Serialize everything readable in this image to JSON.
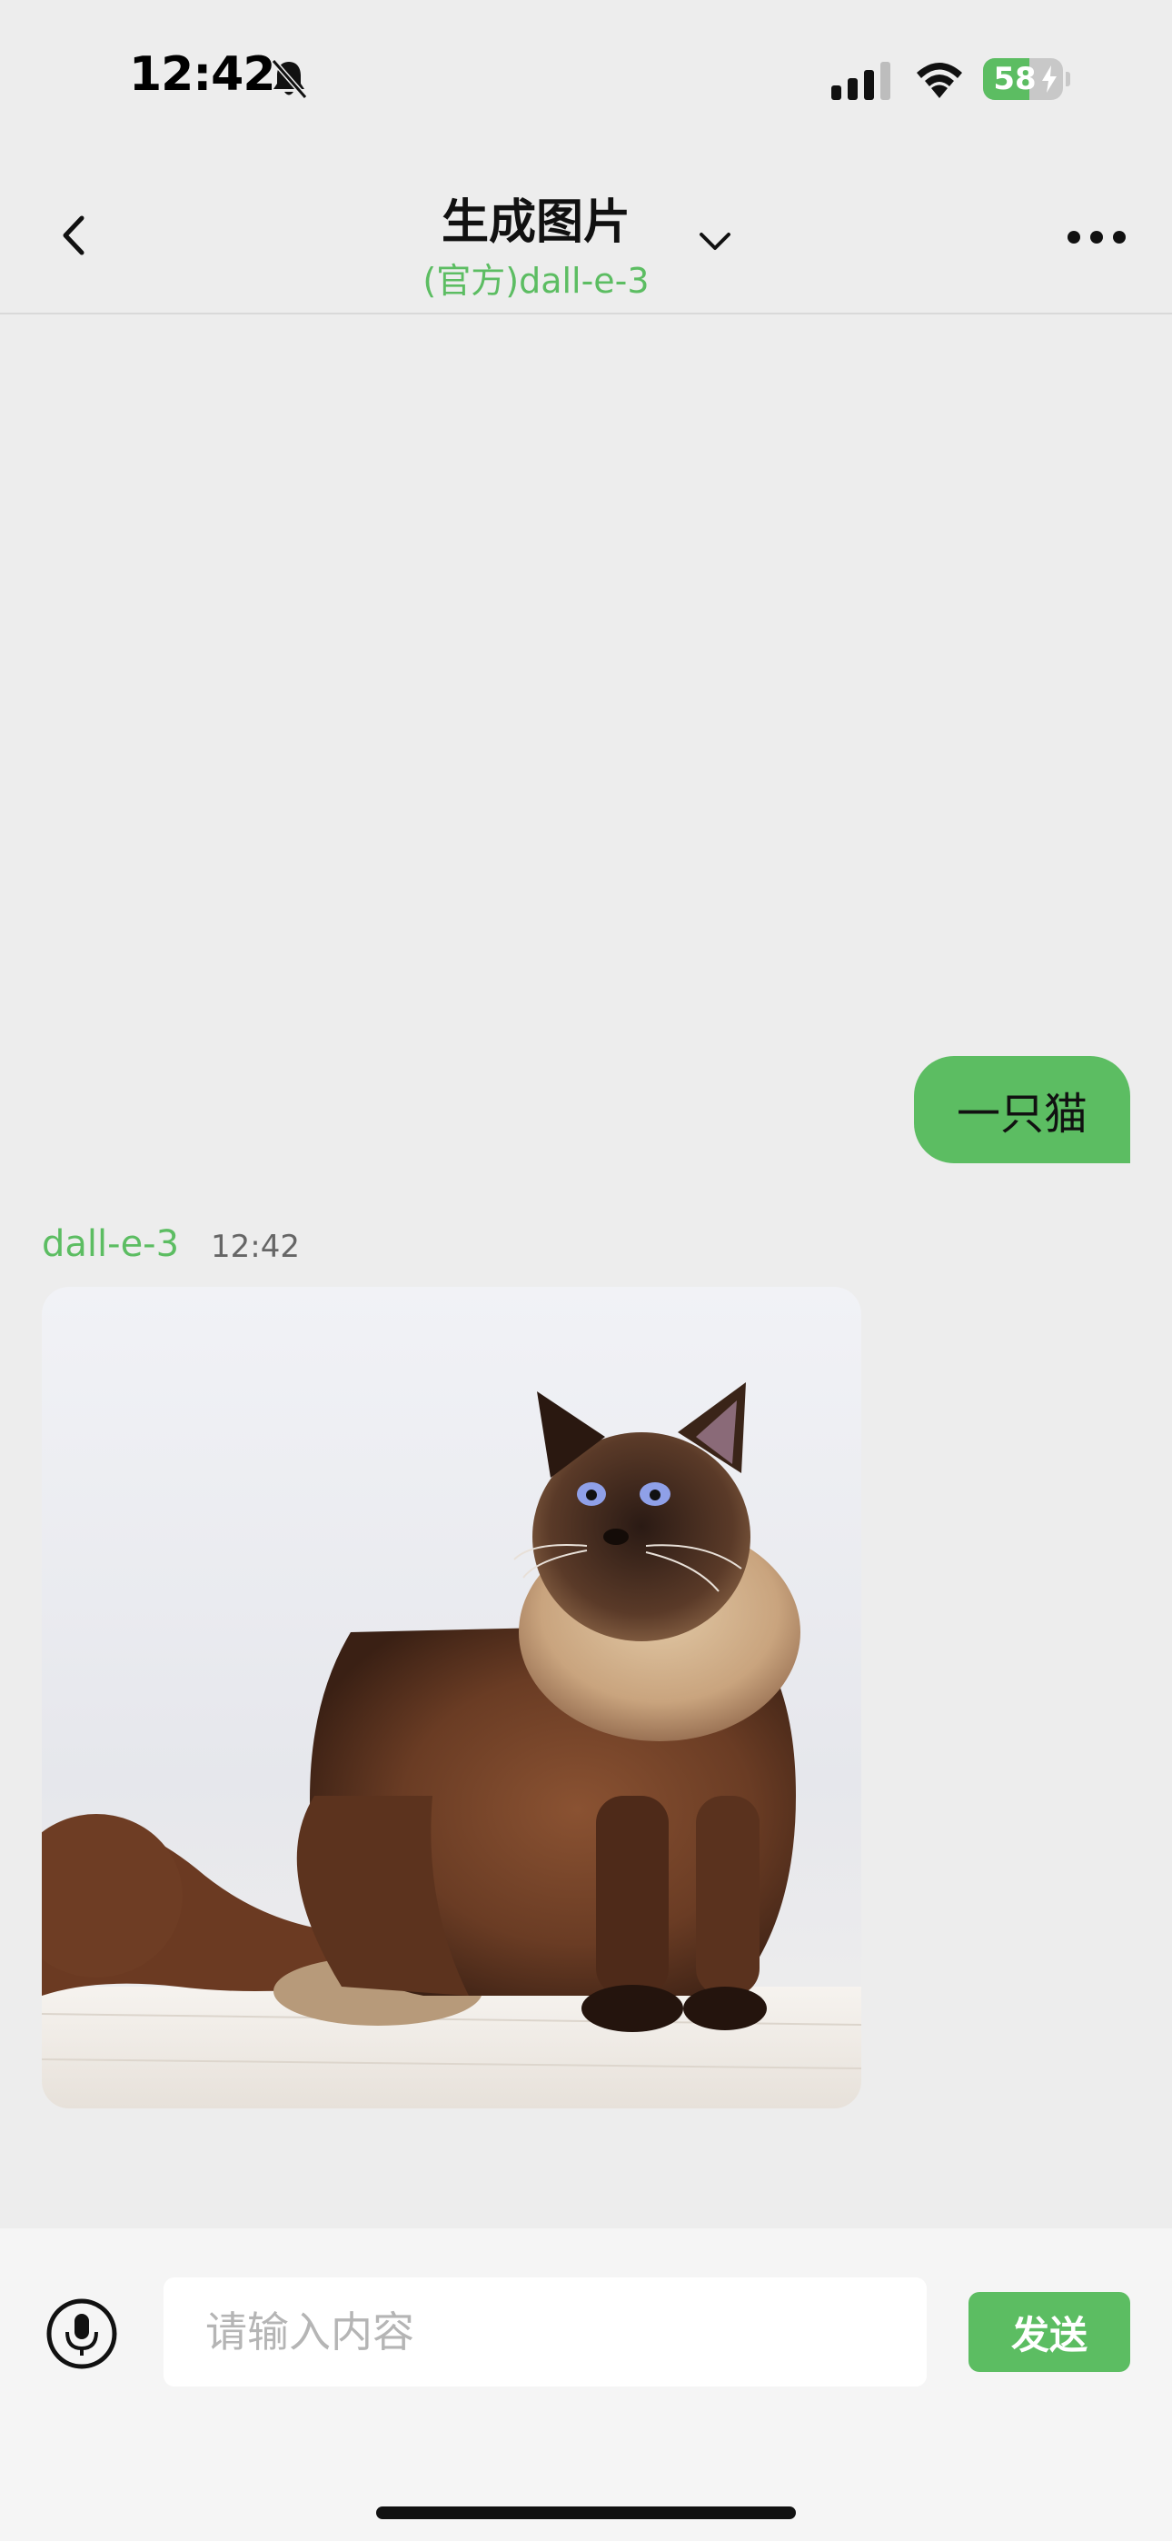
{
  "status_bar": {
    "time": "12:42",
    "battery_level": "58",
    "battery_fraction": 0.58,
    "icons": [
      "bell-slash-icon",
      "cellular-signal-icon",
      "wifi-icon",
      "battery-icon",
      "charging-bolt-icon"
    ]
  },
  "nav": {
    "title": "生成图片",
    "subtitle": "(官方)dall-e-3",
    "icons": [
      "back-chevron-icon",
      "chevron-down-icon",
      "more-dots-icon"
    ]
  },
  "chat": {
    "user_message": "一只猫",
    "bot_name": "dall-e-3",
    "bot_time": "12:42",
    "bot_image_subject": "cat-image"
  },
  "input": {
    "placeholder": "请输入内容",
    "send_label": "发送",
    "icons": [
      "microphone-icon"
    ]
  },
  "colors": {
    "accent": "#5cbd62",
    "background": "#ededed",
    "input_bar": "#f5f5f5"
  }
}
